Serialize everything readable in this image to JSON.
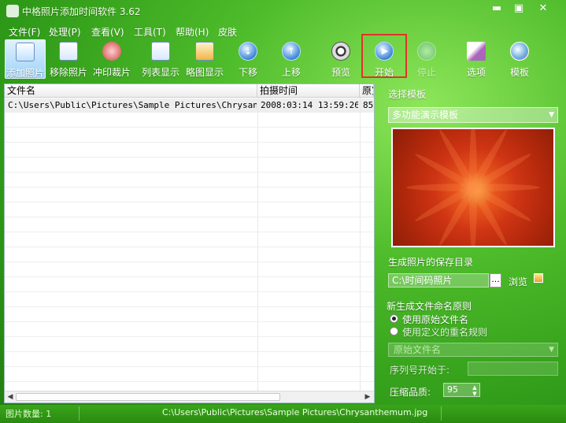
{
  "window": {
    "title": "中格照片添加时间软件 3.62",
    "controls": {
      "minimize": "▬",
      "maximize": "▣",
      "close": "✕"
    }
  },
  "menu": [
    "文件(F)",
    "处理(P)",
    "查看(V)",
    "工具(T)",
    "帮助(H)",
    "皮肤"
  ],
  "toolbar": [
    {
      "label": "添加照片",
      "icon": "add-photo-icon"
    },
    {
      "label": "移除照片",
      "icon": "remove-photo-icon"
    },
    {
      "label": "冲印裁片",
      "icon": "print-crop-icon"
    },
    {
      "label": "列表显示",
      "icon": "list-view-icon"
    },
    {
      "label": "略图显示",
      "icon": "thumbnail-view-icon"
    },
    {
      "label": "下移",
      "icon": "move-down-icon"
    },
    {
      "label": "上移",
      "icon": "move-up-icon"
    },
    {
      "label": "预览",
      "icon": "preview-icon"
    },
    {
      "label": "开始",
      "icon": "start-icon"
    },
    {
      "label": "停止",
      "icon": "stop-icon"
    },
    {
      "label": "选项",
      "icon": "options-icon"
    },
    {
      "label": "模板",
      "icon": "template-icon"
    }
  ],
  "file_list": {
    "columns": [
      "文件名",
      "拍摄时间",
      "原宽"
    ],
    "rows": [
      {
        "file": "C:\\Users\\Public\\Pictures\\Sample Pictures\\Chrysant...",
        "time": "2008:03:14 13:59:26",
        "extra": "85"
      }
    ]
  },
  "template": {
    "section_label": "选择模板",
    "selected": "多功能演示模板"
  },
  "save": {
    "label": "生成照片的保存目录",
    "path": "C:\\时间码照片",
    "dots": "...",
    "browse": "浏览"
  },
  "naming": {
    "label": "新生成文件命名原则",
    "option_original": "使用原始文件名",
    "option_custom": "使用定义的重名规则",
    "selected_rule": "原始文件名",
    "seq_label": "序列号开始于:"
  },
  "quality": {
    "label": "压缩品质:",
    "value": "95"
  },
  "status": {
    "count_label": "图片数量: 1",
    "current_file": "C:\\Users\\Public\\Pictures\\Sample Pictures\\Chrysanthemum.jpg"
  }
}
